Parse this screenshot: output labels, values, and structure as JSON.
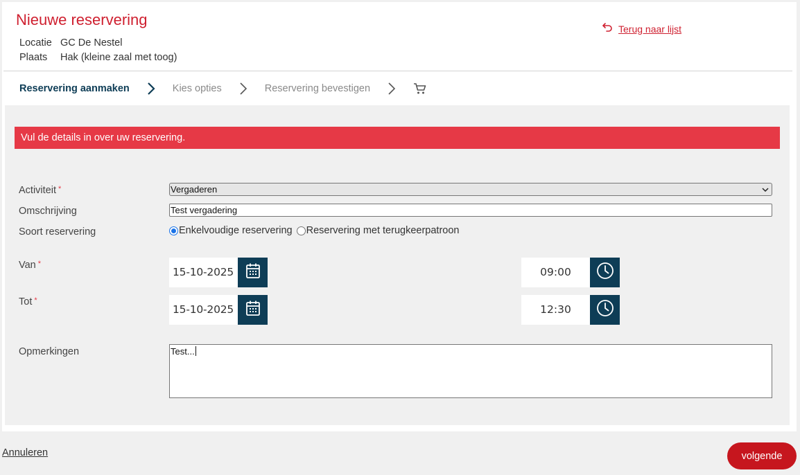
{
  "header": {
    "title": "Nieuwe reservering",
    "location_label": "Locatie",
    "location_value": "GC De Nestel",
    "place_label": "Plaats",
    "place_value": "Hak (kleine zaal met toog)",
    "back_link": "Terug naar lijst",
    "back_icon": "undo-arrow-icon"
  },
  "steps": [
    {
      "label": "Reservering aanmaken",
      "active": true
    },
    {
      "label": "Kies opties",
      "active": false
    },
    {
      "label": "Reservering bevestigen",
      "active": false
    },
    {
      "icon": "shopping-cart-icon"
    }
  ],
  "banner": {
    "text": "Vul de details in over uw reservering."
  },
  "form": {
    "activity_label": "Activiteit",
    "activity_value": "Vergaderen",
    "description_label": "Omschrijving",
    "description_value": "Test vergadering",
    "type_label": "Soort reservering",
    "type_options": [
      {
        "label": "Enkelvoudige reservering",
        "selected": true
      },
      {
        "label": "Reservering met terugkeerpatroon",
        "selected": false
      }
    ],
    "from_label": "Van",
    "from_date": "15-10-2025",
    "from_time": "09:00",
    "to_label": "Tot",
    "to_date": "15-10-2025",
    "to_time": "12:30",
    "remarks_label": "Opmerkingen",
    "remarks_value": "Test...",
    "required_marker": "*"
  },
  "footer": {
    "cancel_label": "Annuleren",
    "next_label": "volgende"
  },
  "colors": {
    "brand_red": "#cf2030",
    "banner_red": "#e63946",
    "navy": "#0e3d56",
    "button_red": "#c6161e"
  }
}
